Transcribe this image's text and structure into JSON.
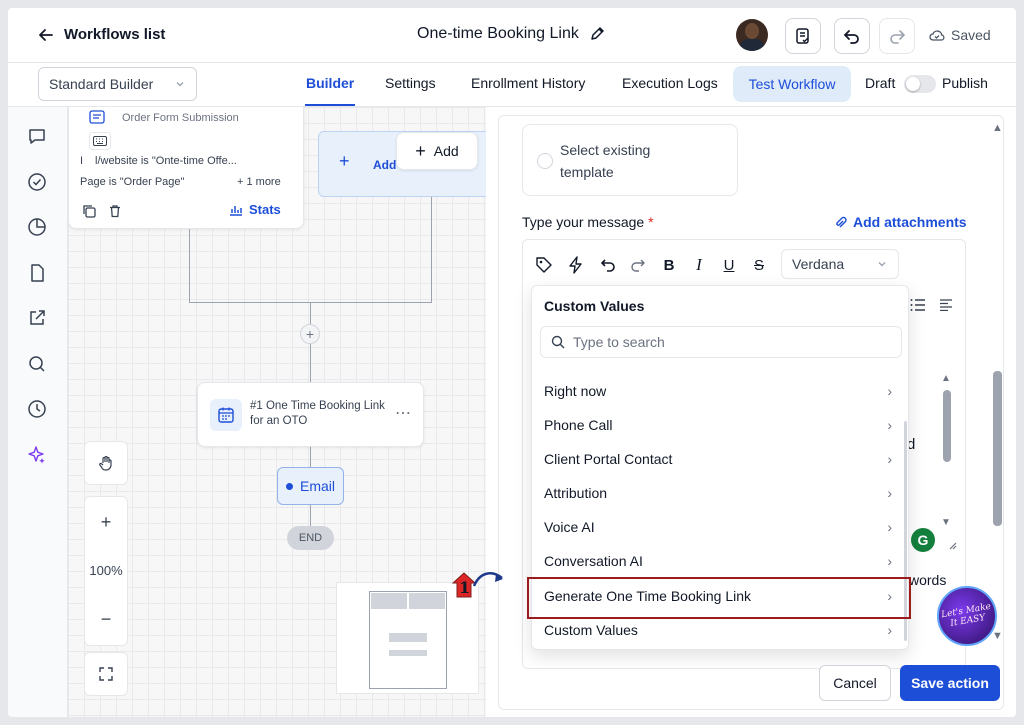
{
  "header": {
    "back_label": "Workflows list",
    "workflow_title": "One-time Booking Link",
    "status": "Saved"
  },
  "subnav": {
    "builder_mode": "Standard Builder",
    "tabs": [
      "Builder",
      "Settings",
      "Enrollment History",
      "Execution Logs"
    ],
    "active_tab": "Builder",
    "test_button": "Test Workflow",
    "draft_label": "Draft",
    "publish_label": "Publish",
    "publish_on": false
  },
  "canvas": {
    "trigger_card": {
      "title": "Order Form Submission",
      "filter1": "l/website is \"Onte-time Offe...",
      "filter1_prefix": "I",
      "filter2": "Page is \"Order Page\"",
      "more": "+ 1 more",
      "stats": "Stats"
    },
    "add_trigger": {
      "label": "Add",
      "popup_label": "Add"
    },
    "action_card": {
      "title": "#1 One Time Booking Link for an OTO"
    },
    "email_node": "Email",
    "end_node": "END",
    "zoom": "100%",
    "zoom_in": "+",
    "zoom_out": "−"
  },
  "panel": {
    "template_option": "Select existing template",
    "message_label": "Type your message",
    "required_mark": "*",
    "attachments": "Add attachments",
    "font": "Verdana",
    "toolbar_letters": {
      "bold": "B",
      "italic": "I",
      "underline": "U",
      "strike": "S"
    },
    "partial_text_d": "d",
    "partial_text_words": "words",
    "cancel": "Cancel",
    "save": "Save action"
  },
  "custom_values": {
    "title": "Custom Values",
    "search_placeholder": "Type to search",
    "items": [
      "Right now",
      "Phone Call",
      "Client Portal Contact",
      "Attribution",
      "Voice AI",
      "Conversation AI",
      "Generate One Time Booking Link",
      "Custom Values"
    ]
  },
  "annotation": {
    "step": "1"
  },
  "watermark": {
    "text": "Let's Make It EASY"
  },
  "colors": {
    "accent": "#1d4ed8",
    "highlight": "#9b1c1c",
    "tab_bg": "#e0ebfa"
  }
}
